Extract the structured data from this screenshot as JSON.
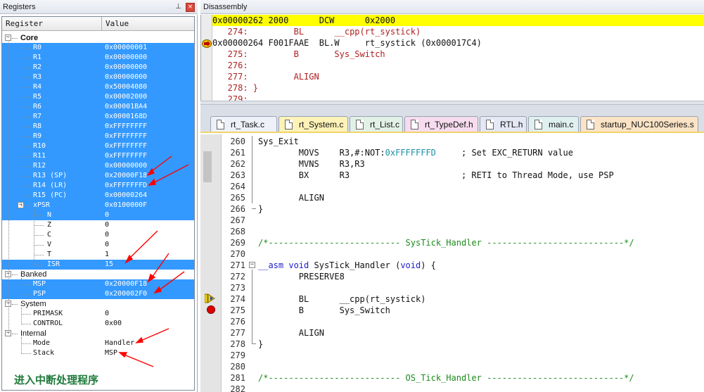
{
  "registers_pane": {
    "title": "Registers",
    "pin_icon": "pin-icon",
    "close_label": "×",
    "col_register": "Register",
    "col_value": "Value",
    "core_label": "Core",
    "core": [
      {
        "name": "R0",
        "value": "0x00000001"
      },
      {
        "name": "R1",
        "value": "0x00000000"
      },
      {
        "name": "R2",
        "value": "0x00000000"
      },
      {
        "name": "R3",
        "value": "0x00000000"
      },
      {
        "name": "R4",
        "value": "0x50004080"
      },
      {
        "name": "R5",
        "value": "0x00002000"
      },
      {
        "name": "R6",
        "value": "0x00001BA4"
      },
      {
        "name": "R7",
        "value": "0x0000168D"
      },
      {
        "name": "R8",
        "value": "0xFFFFFFFF"
      },
      {
        "name": "R9",
        "value": "0xFFFFFFFF"
      },
      {
        "name": "R10",
        "value": "0xFFFFFFFF"
      },
      {
        "name": "R11",
        "value": "0xFFFFFFFF"
      },
      {
        "name": "R12",
        "value": "0x00000000"
      },
      {
        "name": "R13 (SP)",
        "value": "0x20000F18"
      },
      {
        "name": "R14 (LR)",
        "value": "0xFFFFFFFD"
      },
      {
        "name": "R15 (PC)",
        "value": "0x00000264"
      }
    ],
    "xpsr": {
      "name": "xPSR",
      "value": "0x0100000F"
    },
    "xpsr_bits": [
      {
        "name": "N",
        "value": "0"
      },
      {
        "name": "Z",
        "value": "0"
      },
      {
        "name": "C",
        "value": "0"
      },
      {
        "name": "V",
        "value": "0"
      },
      {
        "name": "T",
        "value": "1"
      },
      {
        "name": "ISR",
        "value": "15"
      }
    ],
    "banked_label": "Banked",
    "banked": [
      {
        "name": "MSP",
        "value": "0x20000F18"
      },
      {
        "name": "PSP",
        "value": "0x200002F0"
      }
    ],
    "system_label": "System",
    "system": [
      {
        "name": "PRIMASK",
        "value": "0"
      },
      {
        "name": "CONTROL",
        "value": "0x00"
      }
    ],
    "internal_label": "Internal",
    "internal": [
      {
        "name": "Mode",
        "value": "Handler"
      },
      {
        "name": "Stack",
        "value": "MSP"
      }
    ],
    "caption": "进入中断处理程序"
  },
  "disassembly": {
    "title": "Disassembly",
    "lines": [
      {
        "text": "0x00000262 2000      DCW      0x2000",
        "highlight": true
      },
      {
        "text": "   274:         BL      __cpp(rt_systick)",
        "highlight": false
      },
      {
        "text": "0x00000264 F001FAAE  BL.W     rt_systick (0x000017C4)",
        "highlight": false
      },
      {
        "text": "   275:         B       Sys_Switch",
        "highlight": false
      },
      {
        "text": "   276:",
        "highlight": false
      },
      {
        "text": "   277:         ALIGN",
        "highlight": false
      },
      {
        "text": "   278: }",
        "highlight": false
      },
      {
        "text": "   279:",
        "highlight": false
      }
    ]
  },
  "tabs": [
    {
      "label": "rt_Task.c",
      "color": "#eef1f7"
    },
    {
      "label": "rt_System.c",
      "color": "#fdf2b8"
    },
    {
      "label": "rt_List.c",
      "color": "#e2f1e6"
    },
    {
      "label": "rt_TypeDef.h",
      "color": "#f6dcee"
    },
    {
      "label": "RTL.h",
      "color": "#e4e7f4"
    },
    {
      "label": "main.c",
      "color": "#dff0ee"
    },
    {
      "label": "startup_NUC100Series.s",
      "color": "#fbe3c6"
    }
  ],
  "editor": {
    "lines": [
      {
        "num": "260",
        "text": "Sys_Exit"
      },
      {
        "num": "261",
        "text": "        MOVS    R3,#:NOT:0xFFFFFFFD     ; Set EXC_RETURN value"
      },
      {
        "num": "262",
        "text": "        MVNS    R3,R3"
      },
      {
        "num": "263",
        "text": "        BX      R3                      ; RETI to Thread Mode, use PSP"
      },
      {
        "num": "264",
        "text": ""
      },
      {
        "num": "265",
        "text": "        ALIGN"
      },
      {
        "num": "266",
        "text": "}"
      },
      {
        "num": "267",
        "text": ""
      },
      {
        "num": "268",
        "text": ""
      },
      {
        "num": "269",
        "text": "/*-------------------------- SysTick_Handler ---------------------------*/"
      },
      {
        "num": "270",
        "text": ""
      },
      {
        "num": "271",
        "text": "__asm void SysTick_Handler (void) {"
      },
      {
        "num": "272",
        "text": "        PRESERVE8"
      },
      {
        "num": "273",
        "text": ""
      },
      {
        "num": "274",
        "text": "        BL      __cpp(rt_systick)"
      },
      {
        "num": "275",
        "text": "        B       Sys_Switch"
      },
      {
        "num": "276",
        "text": ""
      },
      {
        "num": "277",
        "text": "        ALIGN"
      },
      {
        "num": "278",
        "text": "}"
      },
      {
        "num": "279",
        "text": ""
      },
      {
        "num": "280",
        "text": ""
      },
      {
        "num": "281",
        "text": "/*-------------------------- OS_Tick_Handler ---------------------------*/"
      },
      {
        "num": "282",
        "text": ""
      }
    ]
  },
  "colors": {
    "selection": "#3399ff",
    "highlight_line": "#ffff00",
    "breakpoint": "#e00000",
    "annotation": "#ff0000",
    "comment": "#1d8a1d",
    "keyword": "#1d1dd1"
  }
}
